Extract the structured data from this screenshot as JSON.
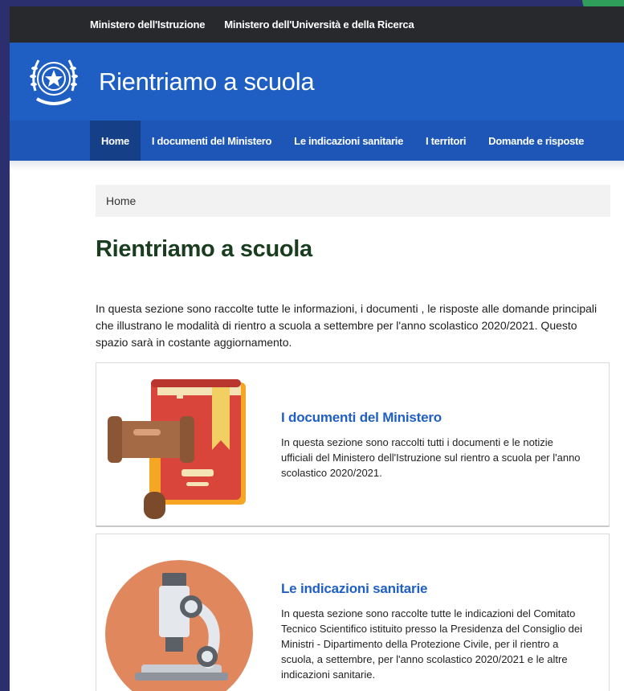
{
  "topbar": {
    "links": [
      "Ministero dell'Istruzione",
      "Ministero dell'Università e della Ricerca"
    ]
  },
  "header": {
    "title": "Rientriamo a scuola",
    "emblem_icon": "italian-republic-emblem"
  },
  "nav": {
    "items": [
      "Home",
      "I documenti del Ministero",
      "Le indicazioni sanitarie",
      "I territori",
      "Domande e risposte"
    ],
    "active": "Home"
  },
  "breadcrumb": {
    "current": "Home"
  },
  "main": {
    "title": "Rientriamo a scuola",
    "intro": "In questa sezione sono raccolte tutte le informazioni, i documenti , le risposte alle domande principali che illustrano le modalità di rientro a scuola a settembre per l'anno scolastico 2020/2021. Questo spazio sarà in costante aggiornamento.",
    "cards": [
      {
        "title": "I documenti del Ministero",
        "description": "In questa sezione sono raccolti tutti i documenti e le notizie ufficiali del Ministero dell'Istruzione sul rientro a scuola per l'anno scolastico 2020/2021.",
        "icon": "book-gavel-icon"
      },
      {
        "title": "Le indicazioni sanitarie",
        "description": "In questa sezione sono raccolte tutte le indicazioni del Comitato Tecnico Scientifico istituito presso la Presidenza del Consiglio dei Ministri - Dipartimento della Protezione Civile, per il rientro a scuola, a settembre, per l'anno scolastico 2020/2021 e le altre indicazioni sanitarie.",
        "icon": "microscope-icon"
      }
    ]
  },
  "colors": {
    "topbar": "#27292d",
    "header": "#1f5fc4",
    "nav_active": "#153f87",
    "title_green": "#1a3d1f",
    "link_blue": "#1f5fc4"
  }
}
